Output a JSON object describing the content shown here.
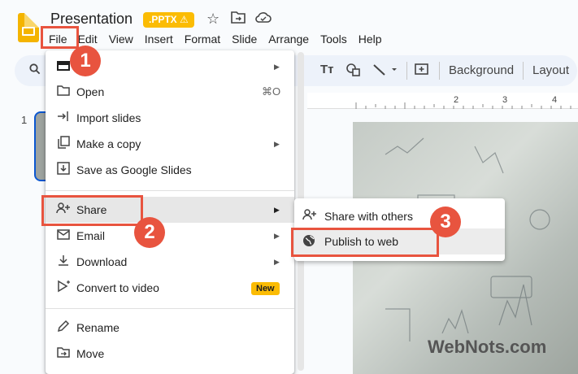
{
  "app": {
    "doc_title": "Presentation",
    "format_badge": ".PPTX",
    "badge_warning": "⚠"
  },
  "menubar": [
    "File",
    "Edit",
    "View",
    "Insert",
    "Format",
    "Slide",
    "Arrange",
    "Tools",
    "Help"
  ],
  "toolbar": {
    "background_label": "Background",
    "layout_label": "Layout"
  },
  "ruler": [
    "2",
    "3",
    "4"
  ],
  "slides_strip": {
    "number": "1"
  },
  "file_menu": {
    "items": [
      {
        "label": "",
        "icon": "slides-icon",
        "submenu": true
      },
      {
        "label": "Open",
        "icon": "folder-icon",
        "shortcut": "⌘O"
      },
      {
        "label": "Import slides",
        "icon": "import-icon"
      },
      {
        "label": "Make a copy",
        "icon": "copy-icon",
        "submenu": true
      },
      {
        "label": "Save as Google Slides",
        "icon": "save-icon"
      },
      {
        "label": "Share",
        "icon": "person-add-icon",
        "submenu": true
      },
      {
        "label": "Email",
        "icon": "mail-icon",
        "submenu": true
      },
      {
        "label": "Download",
        "icon": "download-icon",
        "submenu": true
      },
      {
        "label": "Convert to video",
        "icon": "video-icon",
        "badge": "New"
      },
      {
        "label": "Rename",
        "icon": "pencil-icon"
      },
      {
        "label": "Move",
        "icon": "move-icon"
      }
    ]
  },
  "share_menu": {
    "items": [
      {
        "label": "Share with others",
        "icon": "person-add-icon"
      },
      {
        "label": "Publish to web",
        "icon": "globe-icon"
      }
    ]
  },
  "annotations": {
    "steps": [
      "1",
      "2",
      "3"
    ]
  },
  "watermark": "WebNots.com",
  "colors": {
    "accent": "#e8543f",
    "badge": "#fbbc04",
    "selection": "#0b57d0"
  }
}
